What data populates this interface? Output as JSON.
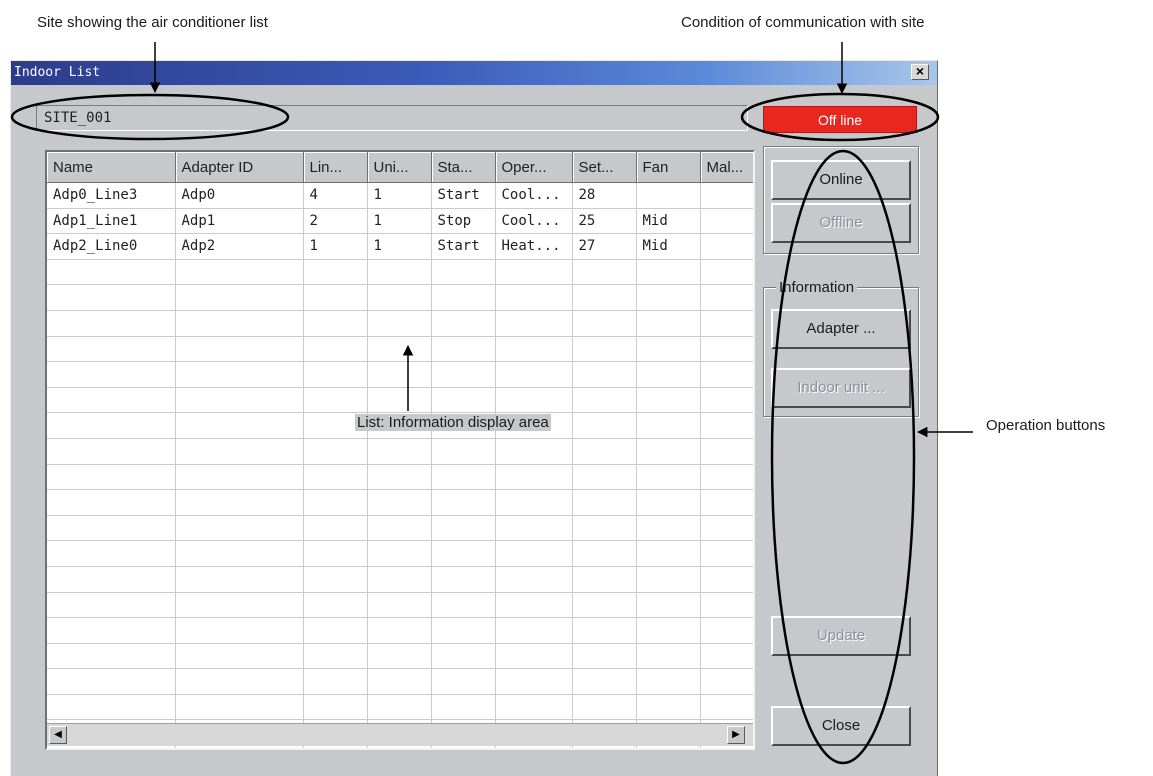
{
  "annotations": {
    "site_caption": "Site showing the air conditioner list",
    "comm_caption": "Condition of communication with site",
    "list_caption": "List: Information display area",
    "ops_caption": "Operation buttons"
  },
  "window": {
    "title": "Indoor List",
    "close_glyph": "×"
  },
  "site": {
    "name": "SITE_001"
  },
  "status": {
    "label": "Off line",
    "color": "#e8271f"
  },
  "table": {
    "columns": [
      "Name",
      "Adapter ID",
      "Lin...",
      "Uni...",
      "Sta...",
      "Oper...",
      "Set...",
      "Fan",
      "Mal..."
    ],
    "rows": [
      [
        "Adp0_Line3",
        "Adp0",
        "4",
        "1",
        "Start",
        "Cool...",
        "28",
        "",
        ""
      ],
      [
        "Adp1_Line1",
        "Adp1",
        "2",
        "1",
        "Stop",
        "Cool...",
        "25",
        "Mid",
        ""
      ],
      [
        "Adp2_Line0",
        "Adp2",
        "1",
        "1",
        "Start",
        "Heat...",
        "27",
        "Mid",
        ""
      ]
    ]
  },
  "scrollbar": {
    "left_icon": "◀",
    "right_icon": "▶"
  },
  "buttons": {
    "online": "Online",
    "offline": "Offline",
    "information_group": "Information",
    "adapter": "Adapter ...",
    "indoor_unit": "Indoor unit ...",
    "update": "Update",
    "close": "Close"
  }
}
